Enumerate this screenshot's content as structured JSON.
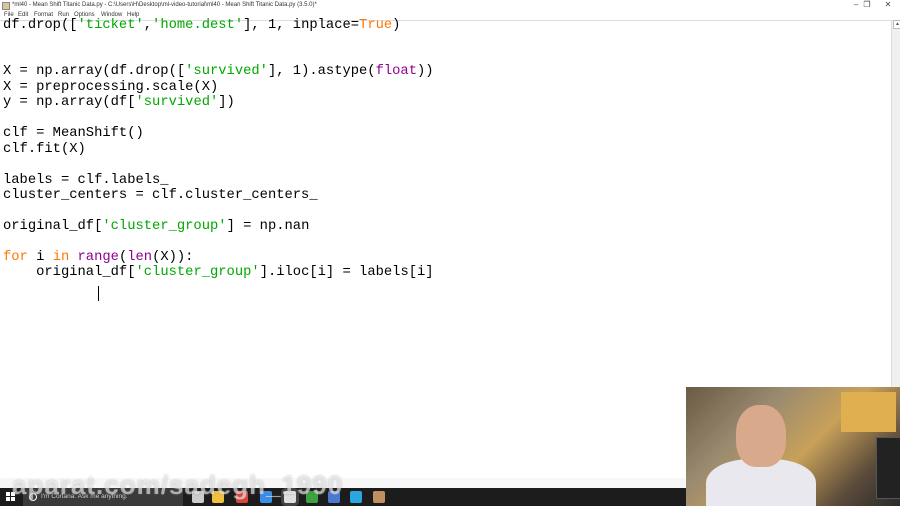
{
  "window": {
    "title": "*ml40 - Mean Shift Titanic Data.py - C:\\Users\\H\\Desktop\\ml-video-tutorial\\ml40 - Mean Shift Titanic Data.py (3.5.0)*",
    "minimize": "–",
    "maximize": "❐",
    "close": "✕"
  },
  "menu": [
    "File",
    "Edit",
    "Format",
    "Run",
    "Options",
    "Window",
    "Help"
  ],
  "code": [
    [
      [
        "df.drop([",
        "p"
      ],
      [
        "'ticket'",
        "str"
      ],
      [
        ",",
        "p"
      ],
      [
        "'home.dest'",
        "str"
      ],
      [
        "], 1, inplace=",
        "p"
      ],
      [
        "True",
        "kw"
      ],
      [
        ")",
        "p"
      ]
    ],
    [],
    [],
    [
      [
        "X = np.array(df.drop([",
        "p"
      ],
      [
        "'survived'",
        "str"
      ],
      [
        "], 1).astype(",
        "p"
      ],
      [
        "float",
        "bi"
      ],
      [
        "))",
        "p"
      ]
    ],
    [
      [
        "X = preprocessing.scale(X)",
        "p"
      ]
    ],
    [
      [
        "y = np.array(df[",
        "p"
      ],
      [
        "'survived'",
        "str"
      ],
      [
        "])",
        "p"
      ]
    ],
    [],
    [
      [
        "clf = MeanShift()",
        "p"
      ]
    ],
    [
      [
        "clf.fit(X)",
        "p"
      ]
    ],
    [],
    [
      [
        "labels = clf.labels_",
        "p"
      ]
    ],
    [
      [
        "cluster_centers = clf.cluster_centers_",
        "p"
      ]
    ],
    [],
    [
      [
        "original_df[",
        "p"
      ],
      [
        "'cluster_group'",
        "str"
      ],
      [
        "] = np.nan",
        "p"
      ]
    ],
    [],
    [
      [
        "for",
        "kw"
      ],
      [
        " i ",
        "p"
      ],
      [
        "in",
        "kw"
      ],
      [
        " ",
        "p"
      ],
      [
        "range",
        "bi"
      ],
      [
        "(",
        "p"
      ],
      [
        "len",
        "bi"
      ],
      [
        "(X)):",
        "p"
      ]
    ],
    [
      [
        "    original_df[",
        "p"
      ],
      [
        "'cluster_group'",
        "str"
      ],
      [
        "].iloc[i] = labels[i]",
        "p"
      ]
    ]
  ],
  "taskbar": {
    "cortana_placeholder": "I'm Cortana. Ask me anything.",
    "apps": [
      {
        "name": "task-view",
        "color": "#cccccc"
      },
      {
        "name": "file-explorer",
        "color": "#f0c040"
      },
      {
        "name": "chrome",
        "color": "#db4437"
      },
      {
        "name": "browser",
        "color": "#3a8ee6"
      },
      {
        "name": "idle-python",
        "color": "#e0e0e0"
      },
      {
        "name": "app-green",
        "color": "#3fa040"
      },
      {
        "name": "network-app",
        "color": "#4a7ad0"
      },
      {
        "name": "app-blue-outline",
        "color": "#2aa6e0"
      },
      {
        "name": "app-brown",
        "color": "#c09060"
      }
    ]
  },
  "watermark": "aparat.com/sadegh_1990"
}
